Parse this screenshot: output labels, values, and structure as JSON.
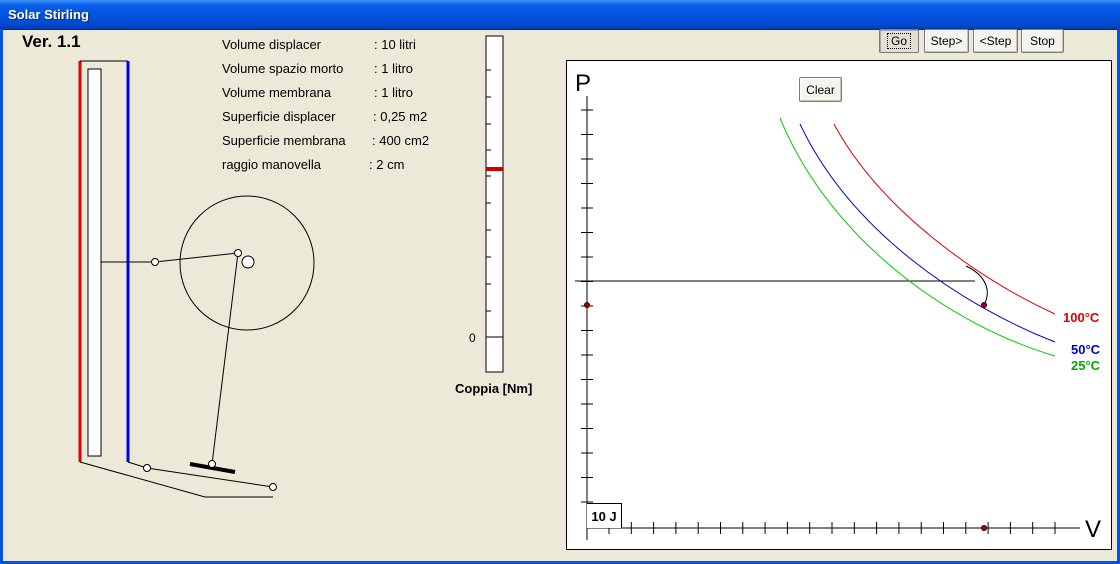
{
  "window": {
    "title": "Solar Stirling"
  },
  "version": "Ver. 1.1",
  "specs": [
    {
      "label": "Volume displacer",
      "value": ": 10 litri"
    },
    {
      "label": "Volume spazio morto",
      "value": ": 1 litro"
    },
    {
      "label": "Volume membrana",
      "value": ": 1 litro"
    },
    {
      "label": "Superficie displacer",
      "value": ":  0,25 m2"
    },
    {
      "label": "Superficie membrana",
      "value": ":  400 cm2"
    },
    {
      "label": "raggio manovella",
      "value": ":   2 cm"
    }
  ],
  "toolbar": {
    "go": "Go",
    "step_fwd": "Step>",
    "step_back": "<Step",
    "stop": "Stop"
  },
  "gauge": {
    "zero_label": "0",
    "caption": "Coppia [Nm]"
  },
  "chart": {
    "clear_label": "Clear",
    "p_axis": "P",
    "v_axis": "V",
    "scale_label": "10 J",
    "legend": {
      "t100": "100°C",
      "t50": "50°C",
      "t25": "25°C"
    }
  },
  "colors": {
    "hot": "#dd0000",
    "mid": "#0000cc",
    "cold": "#00cc00",
    "wall_hot": "#e00000",
    "wall_cold": "#0000ee"
  }
}
